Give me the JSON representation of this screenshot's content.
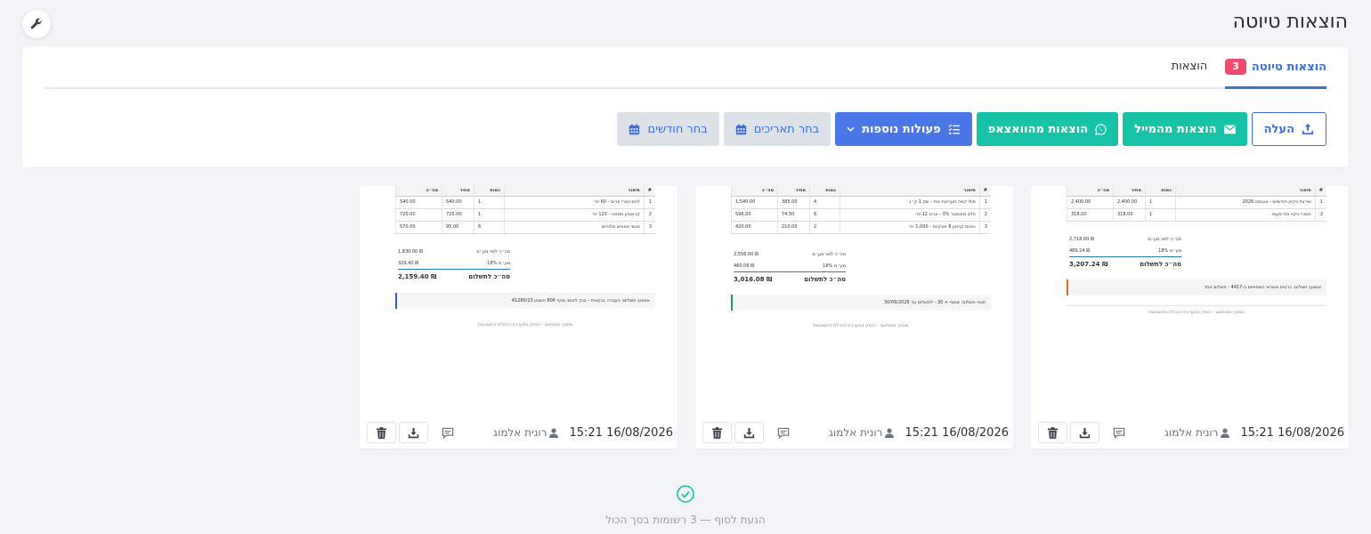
{
  "header": {
    "title": "הוצאות טיוטה"
  },
  "tabs": [
    {
      "label": "הוצאות טיוטה",
      "badge": "3",
      "active": true
    },
    {
      "label": "הוצאות",
      "active": false
    }
  ],
  "toolbar": {
    "upload": "העלה",
    "from_email": "הוצאות מהמייל",
    "from_whatsapp": "הוצאות מהוואצאפ",
    "more_actions": "פעולות נוספות",
    "pick_dates": "בחר תאריכים",
    "pick_months": "בחר חודשים"
  },
  "table_headers": {
    "idx": "#",
    "desc": "תיאור",
    "qty": "כמות",
    "price": "מחיר",
    "total": "סה״כ"
  },
  "totals_labels": {
    "before_vat": "סה״כ לפני מע״מ",
    "vat": "מע״מ 18%",
    "grand": "סה״כ לתשלום"
  },
  "cards": [
    {
      "rows": [
        {
          "idx": "1",
          "desc": "שירותי ניקיון חודשיים - אוגוסט 2026",
          "qty": "1",
          "price": "2,400.00",
          "total": "2,400.00"
        },
        {
          "idx": "2",
          "desc": "חומרי ניקוי וחד-פעמי",
          "qty": "1",
          "price": "318.00",
          "total": "318.00"
        }
      ],
      "before_vat": "2,718.00",
      "vat": "489.24",
      "grand": "3,207.24",
      "note": "אמצעי תשלום: כרטיס אשראי המסתיים ב-4417 - תשלום אחד",
      "footer_note": "מסמך ממוחשב - הופק במערכת הנהלת החשבונות",
      "stripe": "#e0692e",
      "date": "16/08/2026 15:21",
      "user": "רונית אלמוג"
    },
    {
      "rows": [
        {
          "idx": "1",
          "desc": "פולי קפה תערובת בית - שק 1 ק״ג",
          "qty": "4",
          "price": "385.00",
          "total": "1,540.00"
        },
        {
          "idx": "2",
          "desc": "חלב מפוסטר 3% - ארגז 12 יח׳",
          "qty": "8",
          "price": "74.50",
          "total": "596.00"
        },
        {
          "idx": "3",
          "desc": "כוסות קרטון 8 אונקיות - 1,000 יח׳",
          "qty": "2",
          "price": "210.00",
          "total": "420.00"
        }
      ],
      "before_vat": "2,556.00",
      "vat": "460.08",
      "grand": "3,016.08",
      "note": "תנאי תשלום: שוטף + 30 - לתשלום עד 30/09/2026",
      "footer_note": "מסמך ממוחשב - הופק במערכת הנהלת החשבונות",
      "stripe": "#1aa05a",
      "date": "16/08/2026 15:21",
      "user": "רונית אלמוג"
    },
    {
      "rows": [
        {
          "idx": "1",
          "desc": "לחם כפרי פרוס - 60 יח׳",
          "qty": "1",
          "price": "540.00",
          "total": "540.00"
        },
        {
          "idx": "2",
          "desc": "קרואסון חמאה - 120 יח׳",
          "qty": "1",
          "price": "720.00",
          "total": "720.00"
        },
        {
          "idx": "3",
          "desc": "מגשי מאפים מלוחים",
          "qty": "6",
          "price": "95.00",
          "total": "570.00"
        }
      ],
      "before_vat": "1,830.00",
      "vat": "329.40",
      "grand": "2,159.40",
      "note": "אמצעי תשלום: העברה בנקאית - בנק לאומי סניף 806 חשבון 41286/23",
      "footer_note": "מסמך ממוחשב - הופק במערכת הנהלת החשבונות",
      "stripe": "#2f5fc8",
      "date": "16/08/2026 15:21",
      "user": "רונית אלמוג"
    }
  ],
  "end_message": "הגעת לסוף — 3 רשומות בסך הכול",
  "colors": {
    "primary": "#3b6fe0",
    "teal": "#17c3a6",
    "badge": "#ef4b6c",
    "success": "#17c3a6"
  },
  "icons": {
    "wrench": "wrench-icon",
    "upload": "upload-icon",
    "envelope": "envelope-icon",
    "whatsapp": "whatsapp-icon",
    "tasks": "tasks-icon",
    "chevron": "chevron-down-icon",
    "calendar": "calendar-icon",
    "user": "user-icon",
    "comment": "comment-icon",
    "download": "download-icon",
    "trash": "trash-icon",
    "check": "check-circle-icon"
  }
}
